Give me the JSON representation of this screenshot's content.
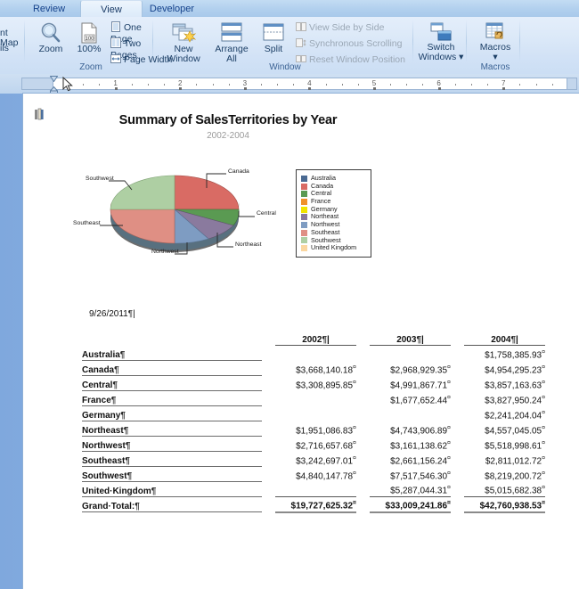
{
  "app": {
    "ribbon_tabs": [
      {
        "label": "Review",
        "active": false
      },
      {
        "label": "View",
        "active": true
      },
      {
        "label": "Developer",
        "active": false
      }
    ],
    "clipped_left_items": [
      "nt Map",
      "ils"
    ],
    "groups": [
      {
        "name": "Zoom",
        "buttons": [
          {
            "label": "Zoom",
            "icon": "magnifier-icon",
            "enabled": true
          },
          {
            "label": "100%",
            "icon": "page-100-icon",
            "enabled": true
          },
          {
            "label": "One Page",
            "icon": "one-page-icon",
            "enabled": true
          },
          {
            "label": "Two Pages",
            "icon": "two-pages-icon",
            "enabled": true
          },
          {
            "label": "Page Width",
            "icon": "page-width-icon",
            "enabled": true
          }
        ]
      },
      {
        "name": "Window",
        "buttons": [
          {
            "label": "New Window",
            "icon": "new-window-icon",
            "enabled": true
          },
          {
            "label": "Arrange All",
            "icon": "arrange-all-icon",
            "enabled": true
          },
          {
            "label": "Split",
            "icon": "split-icon",
            "enabled": true
          },
          {
            "label": "View Side by Side",
            "icon": "side-by-side-icon",
            "enabled": false
          },
          {
            "label": "Synchronous Scrolling",
            "icon": "sync-scroll-icon",
            "enabled": false
          },
          {
            "label": "Reset Window Position",
            "icon": "reset-window-icon",
            "enabled": false
          }
        ]
      },
      {
        "name": "Macros",
        "buttons": [
          {
            "label": "Switch Windows",
            "icon": "switch-windows-icon",
            "enabled": true,
            "dropdown": true
          },
          {
            "label": "Macros",
            "icon": "macros-icon",
            "enabled": true,
            "dropdown": true
          }
        ]
      }
    ],
    "ruler": {
      "numbers": [
        "1",
        "2",
        "3",
        "4",
        "5",
        "6",
        "7"
      ],
      "unit": "inch"
    }
  },
  "document": {
    "datestamp": "9/26/2011",
    "pilcrow": "¶",
    "cellmark": "¤",
    "insertion_bar": "|"
  },
  "chart_data": {
    "type": "pie",
    "title": "Summary of SalesTerritories by Year",
    "subtitle": "2002-2004",
    "xlabel": "",
    "ylabel": "",
    "legend_position": "right",
    "grid": false,
    "categories": [
      "Australia",
      "Canada",
      "Central",
      "France",
      "Germany",
      "Northeast",
      "Northwest",
      "Southeast",
      "Southwest",
      "United Kingdom"
    ],
    "colors": [
      "#4a6a92",
      "#d96b64",
      "#5a9a52",
      "#f0912b",
      "#f2e400",
      "#8a7a9e",
      "#7e9cc2",
      "#df8f84",
      "#aecfa3",
      "#fbd7a0"
    ],
    "slices": [
      {
        "label": "Canada",
        "value": 11591364.76,
        "color": "#d96b64",
        "pct": 18.5
      },
      {
        "label": "Central",
        "value": 12157927.19,
        "color": "#5a9a52",
        "pct": 13.0
      },
      {
        "label": "Northeast",
        "value": 11252038.77,
        "color": "#8a7a9e",
        "pct": 11.5
      },
      {
        "label": "Northwest",
        "value": 11396794.91,
        "color": "#7e9cc2",
        "pct": 11.5
      },
      {
        "label": "Southeast",
        "value": 8714865.97,
        "color": "#df8f84",
        "pct": 17.0
      },
      {
        "label": "Southwest",
        "value": 20576894.8,
        "color": "#aecfa3",
        "pct": 28.5
      }
    ],
    "callouts": [
      "Canada",
      "Central",
      "Northeast",
      "Northwest",
      "Southeast",
      "Southwest"
    ]
  },
  "table": {
    "row_header_blank": "",
    "columns": [
      "2002",
      "2003",
      "2004"
    ],
    "rows": [
      {
        "label": "Australia",
        "values": [
          "",
          "",
          "$1,758,385.93"
        ]
      },
      {
        "label": "Canada",
        "values": [
          "$3,668,140.18",
          "$2,968,929.35",
          "$4,954,295.23"
        ]
      },
      {
        "label": "Central",
        "values": [
          "$3,308,895.85",
          "$4,991,867.71",
          "$3,857,163.63"
        ]
      },
      {
        "label": "France",
        "values": [
          "",
          "$1,677,652.44",
          "$3,827,950.24"
        ]
      },
      {
        "label": "Germany",
        "values": [
          "",
          "",
          "$2,241,204.04"
        ]
      },
      {
        "label": "Northeast",
        "values": [
          "$1,951,086.83",
          "$4,743,906.89",
          "$4,557,045.05"
        ]
      },
      {
        "label": "Northwest",
        "values": [
          "$2,716,657.68",
          "$3,161,138.62",
          "$5,518,998.61"
        ]
      },
      {
        "label": "Southeast",
        "values": [
          "$3,242,697.01",
          "$2,661,156.24",
          "$2,811,012.72"
        ]
      },
      {
        "label": "Southwest",
        "values": [
          "$4,840,147.78",
          "$7,517,546.30",
          "$8,219,200.72"
        ]
      },
      {
        "label": "United·Kingdom",
        "values": [
          "",
          "$5,287,044.31",
          "$5,015,682.38"
        ]
      }
    ],
    "total": {
      "label": "Grand·Total:",
      "values": [
        "$19,727,625.32",
        "$33,009,241.86",
        "$42,760,938.53"
      ]
    }
  }
}
